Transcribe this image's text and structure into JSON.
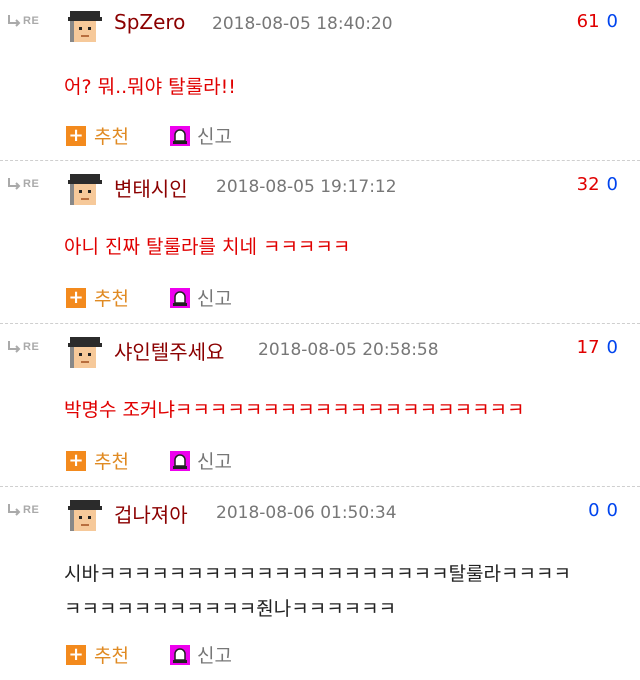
{
  "theme": {
    "author_color": "#8b0000",
    "body_red": "#e00000",
    "body_dark": "#222222",
    "upvote_color": "#e00000",
    "downvote_color": "#0044ee",
    "recommend_color": "#f38a1d",
    "report_color": "#ee00ee"
  },
  "labels": {
    "reply_mark": "RE",
    "recommend": "추천",
    "recommend_icon": "+",
    "report": "신고"
  },
  "comments": [
    {
      "author": "SpZero",
      "timestamp": "2018-08-05 18:40:20",
      "upvotes": "61",
      "downvotes": "0",
      "text_color": "red",
      "lines": [
        "어? 뭐..뭐야 탈룰라!!"
      ]
    },
    {
      "author": "변태시인",
      "timestamp": "2018-08-05 19:17:12",
      "upvotes": "32",
      "downvotes": "0",
      "text_color": "red",
      "lines": [
        "아니 진짜 탈룰라를 치네 ㅋㅋㅋㅋㅋ"
      ]
    },
    {
      "author": "샤인텔주세요",
      "timestamp": "2018-08-05 20:58:58",
      "upvotes": "17",
      "downvotes": "0",
      "text_color": "red",
      "lines": [
        "박명수 조커냐ㅋㅋㅋㅋㅋㅋㅋㅋㅋㅋㅋㅋㅋㅋㅋㅋㅋㅋㅋㅋ"
      ]
    },
    {
      "author": "겁나져아",
      "timestamp": "2018-08-06 01:50:34",
      "upvotes": "0",
      "downvotes": "0",
      "text_color": "dark",
      "lines": [
        "시바ㅋㅋㅋㅋㅋㅋㅋㅋㅋㅋㅋㅋㅋㅋㅋㅋㅋㅋㅋㅋ탈룰라ㅋㅋㅋㅋ",
        "ㅋㅋㅋㅋㅋㅋㅋㅋㅋㅋㅋ줜나ㅋㅋㅋㅋㅋㅋ"
      ]
    }
  ]
}
